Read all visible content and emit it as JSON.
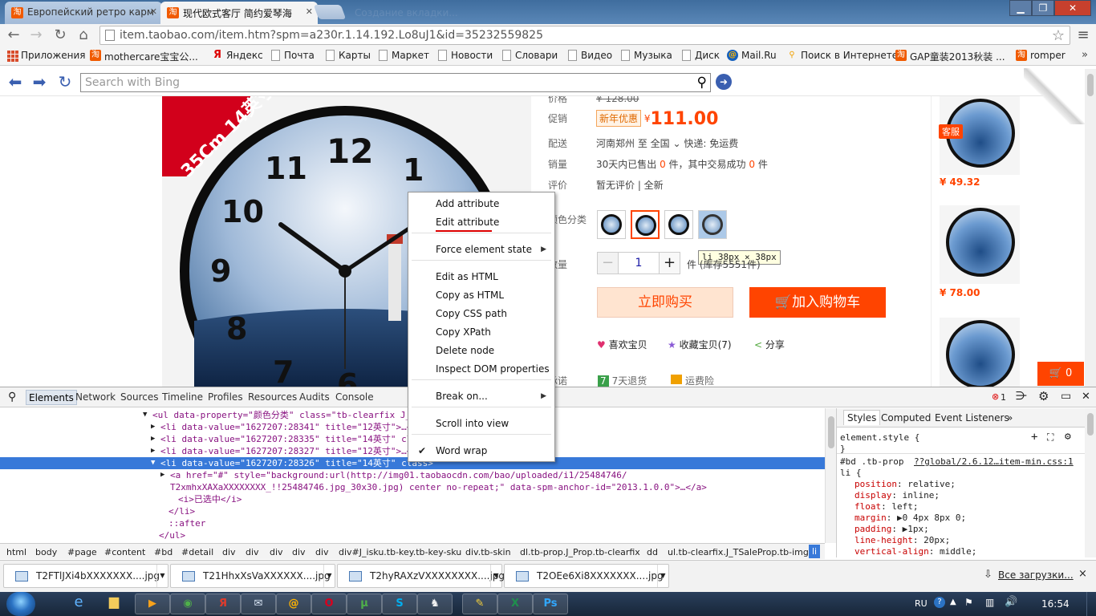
{
  "browser": {
    "tabs": [
      {
        "favicon": "淘",
        "title": "Европейский ретро карм"
      },
      {
        "favicon": "淘",
        "title": "现代欧式客厅 简约爱琴海"
      }
    ],
    "ghost_tab": "Создание вкладки...",
    "url": "item.taobao.com/item.htm?spm=a230r.1.14.192.Lo8uJ1&id=35232559825",
    "bookmarks": [
      {
        "icon": "apps-icon",
        "label": "Приложения"
      },
      {
        "icon": "taobao-icon",
        "label": "mothercare宝宝公..."
      },
      {
        "icon": "yandex-icon",
        "label": "Яндекс"
      },
      {
        "icon": "page-icon",
        "label": "Почта"
      },
      {
        "icon": "page-icon",
        "label": "Карты"
      },
      {
        "icon": "page-icon",
        "label": "Маркет"
      },
      {
        "icon": "page-icon",
        "label": "Новости"
      },
      {
        "icon": "page-icon",
        "label": "Словари"
      },
      {
        "icon": "page-icon",
        "label": "Видео"
      },
      {
        "icon": "page-icon",
        "label": "Музыка"
      },
      {
        "icon": "page-icon",
        "label": "Диск"
      },
      {
        "icon": "mailru-icon",
        "label": "Mail.Ru"
      },
      {
        "icon": "search-icon",
        "label": "Поиск в Интернете"
      },
      {
        "icon": "taobao-icon",
        "label": "GAP童装2013秋装 ..."
      },
      {
        "icon": "taobao-icon",
        "label": "romper"
      }
    ],
    "bookmarks_more": "»"
  },
  "bingbar": {
    "placeholder": "Search with Bing"
  },
  "product": {
    "ribbon": "35Cm 14英寸",
    "clock_numbers": [
      "12",
      "1",
      "11",
      "10",
      "9",
      "8",
      "7",
      "6"
    ],
    "price_label": "价格",
    "price_old": "¥ 128.00",
    "promo_label": "促销",
    "promo_tag": "新年优惠",
    "yen": "¥",
    "price": "111.00",
    "ship_label": "配送",
    "ship_text": "河南郑州 至 全国",
    "ship_arrow": "⌄",
    "ship_express": "快递: 免运费",
    "sales_label": "销量",
    "sales_a": "30天内已售出 ",
    "sales_num1": "0",
    "sales_b": " 件，其中交易成功 ",
    "sales_num2": "0",
    "sales_c": " 件",
    "review_label": "评价",
    "review_text": "暂无评价 | 全新",
    "color_label": "颜色分类",
    "tooltip": "li  38px × 38px",
    "qty_label": "数量",
    "qty_value": "1",
    "qty_minus": "−",
    "qty_plus": "+",
    "stock_text": "件 (库存5551件)",
    "buy_now": "立即购买",
    "add_cart": "加入购物车",
    "cart_glyph": "🛒",
    "like_glyph": "♥",
    "like": "喜欢宝贝",
    "fav_glyph": "★",
    "fav": "收藏宝贝(7)",
    "share_glyph": "<",
    "share": "分享",
    "promise_label": "承诺",
    "promise_7": "7",
    "promise_return": "7天退货",
    "insurance": "运费险"
  },
  "sidebar": {
    "service": "客服",
    "prices": [
      "¥ 49.32",
      "¥ 78.00"
    ],
    "cart_count": "0"
  },
  "devtools": {
    "tabs": [
      "Elements",
      "Network",
      "Sources",
      "Timeline",
      "Profiles",
      "Resources",
      "Audits",
      "Console"
    ],
    "error_count": "1",
    "styles_tabs": [
      "Styles",
      "Computed",
      "Event Listeners",
      "»"
    ],
    "dom_lines": [
      {
        "indent": 190,
        "arrow": "▼",
        "html": "<ul data-property=\"颜色分类\" class=\"tb-clearfix J_TSaleProp tb-img\">"
      },
      {
        "indent": 200,
        "arrow": "▶",
        "html": "<li data-value=\"1627207:28341\" title=\"12英寸\">…</li>"
      },
      {
        "indent": 200,
        "arrow": "▶",
        "html": "<li data-value=\"1627207:28335\" title=\"14英寸\" class=\"tb-selected\">…</li>"
      },
      {
        "indent": 200,
        "arrow": "▶",
        "html": "<li data-value=\"1627207:28327\" title=\"12英寸\">…</li>"
      },
      {
        "indent": 200,
        "arrow": "▼",
        "html": "<li data-value=\"1627207:28326\" title=\"14英寸\" class>",
        "selected": true
      },
      {
        "indent": 212,
        "arrow": "▶",
        "html": "<a href=\"#\" style=\"background:url(http://img01.taobaocdn.com/bao/uploaded/i1/25484746/"
      },
      {
        "indent": 212,
        "arrow": "",
        "html": "T2xmhxXAXaXXXXXXXX_!!25484746.jpg_30x30.jpg) center no-repeat;\" data-spm-anchor-id=\"2013.1.0.0\">…</a>"
      },
      {
        "indent": 222,
        "arrow": "",
        "html": "<i>已选中</i>"
      },
      {
        "indent": 210,
        "arrow": "",
        "html": "</li>"
      },
      {
        "indent": 210,
        "arrow": "",
        "html": "::after"
      },
      {
        "indent": 198,
        "arrow": "",
        "html": "</ul>"
      }
    ],
    "styles": {
      "element_style": "element.style {",
      "element_close": "}",
      "rule_selector": "#bd .tb-prop",
      "rule_source": "??global/2.6.12…item-min.css:1",
      "rule_selector2": "li {",
      "props": [
        {
          "name": "position",
          "value": "relative;"
        },
        {
          "name": "display",
          "value": "inline;"
        },
        {
          "name": "float",
          "value": "left;"
        },
        {
          "name": "margin",
          "value": "▶0 4px 8px 0;"
        },
        {
          "name": "padding",
          "value": "▶1px;"
        },
        {
          "name": "line-height",
          "value": "20px;"
        },
        {
          "name": "vertical-align",
          "value": "middle;"
        }
      ]
    },
    "breadcrumbs": [
      "html",
      "body",
      "#page",
      "#content",
      "#bd",
      "#detail",
      "div",
      "div",
      "div",
      "div",
      "div",
      "div#J_isku.tb-key.tb-key-sku",
      "div.tb-skin",
      "dl.tb-prop.J_Prop.tb-clearfix",
      "dd",
      "ul.tb-clearfix.J_TSaleProp.tb-img",
      "li"
    ]
  },
  "context_menu": {
    "items": [
      {
        "label": "Add attribute"
      },
      {
        "label": "Edit attribute"
      },
      {
        "label": "Force element state",
        "submenu": true
      },
      {
        "label": "Edit as HTML"
      },
      {
        "label": "Copy as HTML"
      },
      {
        "label": "Copy CSS path"
      },
      {
        "label": "Copy XPath"
      },
      {
        "label": "Delete node"
      },
      {
        "label": "Inspect DOM properties"
      },
      {
        "label": "Break on...",
        "submenu": true
      },
      {
        "label": "Scroll into view"
      },
      {
        "label": "Word wrap",
        "checked": true
      }
    ]
  },
  "downloads": {
    "items": [
      "T2FTlJXi4bXXXXXXX....jpg",
      "T21HhxXsVaXXXXXX....jpg",
      "T2hyRAXzVXXXXXXXX....jpg",
      "T2OEe6Xi8XXXXXXX....jpg"
    ],
    "show_all": "Все загрузки...",
    "close": "×"
  },
  "taskbar": {
    "apps": [
      {
        "icon": "media-player-icon",
        "glyph": "▶",
        "color": "#f7a21b"
      },
      {
        "icon": "chrome-icon",
        "glyph": "◉",
        "color": "#4fb04a"
      },
      {
        "icon": "yandex-browser-icon",
        "glyph": "Я",
        "color": "#e03b2c"
      },
      {
        "icon": "mail-icon",
        "glyph": "✉",
        "color": "#d7e3f2"
      },
      {
        "icon": "mailru-agent-icon",
        "glyph": "@",
        "color": "#ffb400"
      },
      {
        "icon": "opera-icon",
        "glyph": "O",
        "color": "#d9001e"
      },
      {
        "icon": "utorrent-icon",
        "glyph": "µ",
        "color": "#4fb04a"
      },
      {
        "icon": "skype-icon",
        "glyph": "S",
        "color": "#00aff0"
      },
      {
        "icon": "game-icon",
        "glyph": "♞",
        "color": "#f1f1f1"
      },
      {
        "icon": "paint-icon",
        "glyph": "✎",
        "color": "#f7d23b"
      },
      {
        "icon": "excel-icon",
        "glyph": "X",
        "color": "#1f8f4d"
      },
      {
        "icon": "photoshop-icon",
        "glyph": "Ps",
        "color": "#31a8ff"
      }
    ],
    "lang": "RU",
    "time": "16:54"
  }
}
